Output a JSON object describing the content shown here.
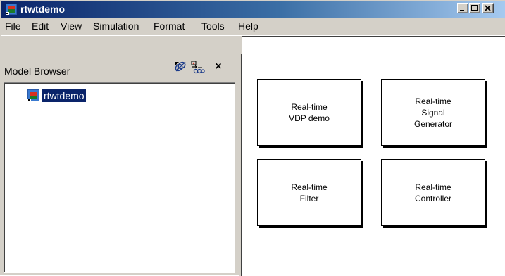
{
  "window": {
    "title": "rtwtdemo",
    "icon": "simulink-model-icon",
    "caption_buttons": [
      "minimize-icon",
      "maximize-icon",
      "close-icon"
    ]
  },
  "menu": [
    "File",
    "Edit",
    "View",
    "Simulation",
    "Format",
    "Tools",
    "Help"
  ],
  "model_browser": {
    "title": "Model Browser",
    "toolbar_icons": [
      "browse-link-icon",
      "show-libraries-icon",
      "close-icon"
    ],
    "close_glyph": "×",
    "tree": [
      {
        "label": "rtwtdemo",
        "icon": "simulink-model-icon",
        "selected": true
      }
    ]
  },
  "diagram": {
    "blocks": [
      {
        "text": "Real-time\nVDP demo"
      },
      {
        "text": "Real-time\nSignal\nGenerator"
      },
      {
        "text": "Real-time\nFilter"
      },
      {
        "text": "Real-time\nController"
      }
    ]
  },
  "colors": {
    "titlebar_start": "#0a246a",
    "titlebar_end": "#a6caf0",
    "selection": "#0a246a",
    "face": "#d4d0c8"
  }
}
